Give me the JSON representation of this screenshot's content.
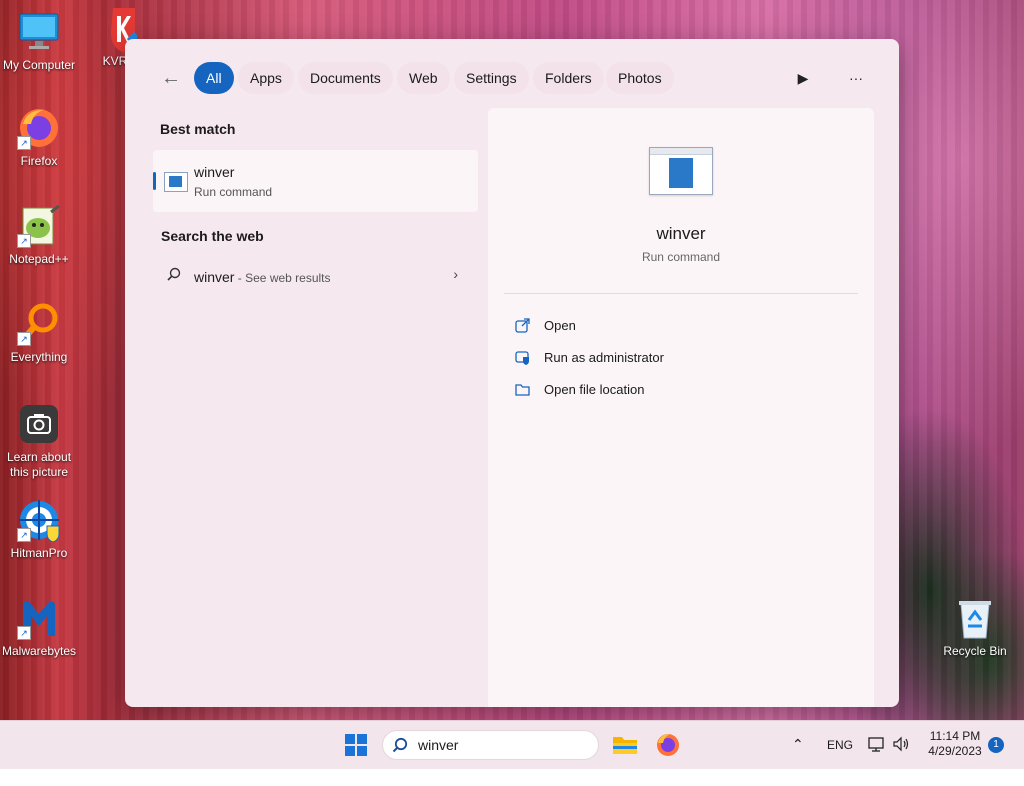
{
  "desktop": {
    "icons": [
      {
        "label": "My Computer"
      },
      {
        "label": "KVR"
      },
      {
        "label": "Firefox"
      },
      {
        "label": "Notepad++"
      },
      {
        "label": "Everything"
      },
      {
        "label": "Learn about this picture"
      },
      {
        "label": "HitmanPro"
      },
      {
        "label": "Malwarebytes"
      },
      {
        "label": "Recycle Bin"
      }
    ]
  },
  "search_panel": {
    "tabs": [
      {
        "label": "All",
        "active": true
      },
      {
        "label": "Apps"
      },
      {
        "label": "Documents"
      },
      {
        "label": "Web"
      },
      {
        "label": "Settings"
      },
      {
        "label": "Folders"
      },
      {
        "label": "Photos"
      }
    ],
    "best_match": {
      "heading": "Best match",
      "title": "winver",
      "subtitle": "Run command"
    },
    "search_web": {
      "heading": "Search the web",
      "query": "winver",
      "suffix": " - See web results"
    },
    "detail": {
      "title": "winver",
      "subtitle": "Run command",
      "actions": [
        {
          "label": "Open",
          "icon": "open-icon"
        },
        {
          "label": "Run as administrator",
          "icon": "shield-icon"
        },
        {
          "label": "Open file location",
          "icon": "folder-icon"
        }
      ]
    }
  },
  "taskbar": {
    "search_value": "winver",
    "language": "ENG",
    "time": "11:14 PM",
    "date": "4/29/2023",
    "notification_count": "1"
  },
  "colors": {
    "accent": "#1565c0",
    "panel_bg": "#f6e8ef"
  }
}
